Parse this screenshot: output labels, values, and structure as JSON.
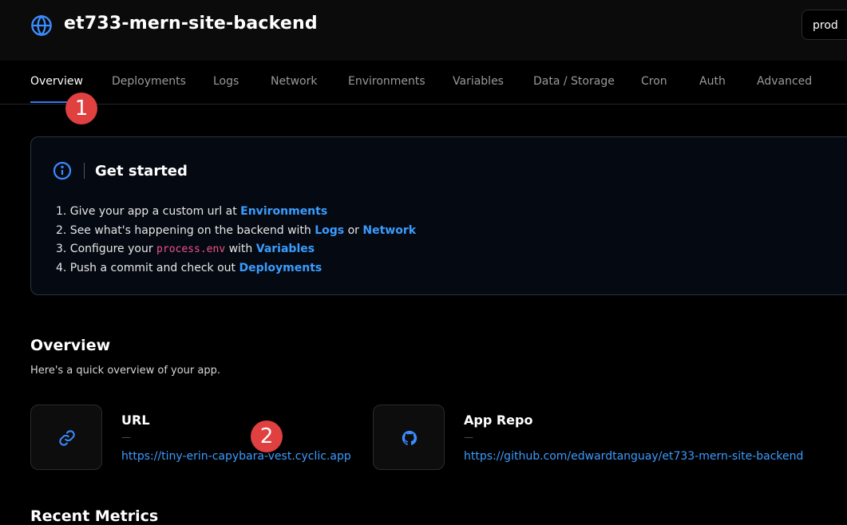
{
  "header": {
    "app_title": "et733-mern-site-backend",
    "env_label": "prod"
  },
  "tabs": [
    "Overview",
    "Deployments",
    "Logs",
    "Network",
    "Environments",
    "Variables",
    "Data / Storage",
    "Cron",
    "Auth",
    "Advanced"
  ],
  "markers": [
    "1",
    "2"
  ],
  "get_started": {
    "title": "Get started",
    "step1_text": "1. Give your app a custom url at ",
    "step1_link": "Environments",
    "step2_text": "2. See what's happening on the backend with ",
    "step2_link1": "Logs",
    "step2_or": " or ",
    "step2_link2": "Network",
    "step3_text": "3. Configure your ",
    "step3_code": "process.env",
    "step3_with": " with ",
    "step3_link": "Variables",
    "step4_text": "4. Push a commit and check out ",
    "step4_link": "Deployments"
  },
  "overview": {
    "title": "Overview",
    "subtitle": "Here's a quick overview of your app.",
    "url_title": "URL",
    "url_dash": "—",
    "url_link": "https://tiny-erin-capybara-vest.cyclic.app",
    "repo_title": "App Repo",
    "repo_dash": "—",
    "repo_link": "https://github.com/edwardtanguay/et733-mern-site-backend"
  },
  "next_heading": "Recent Metrics",
  "colors": {
    "accent": "#2f7bf0",
    "link": "#3b9cff",
    "marker": "#e0403f",
    "code": "#f0528a"
  },
  "icons": {
    "app": "globe-icon",
    "info": "info-icon",
    "url": "link-icon",
    "repo": "github-icon"
  }
}
